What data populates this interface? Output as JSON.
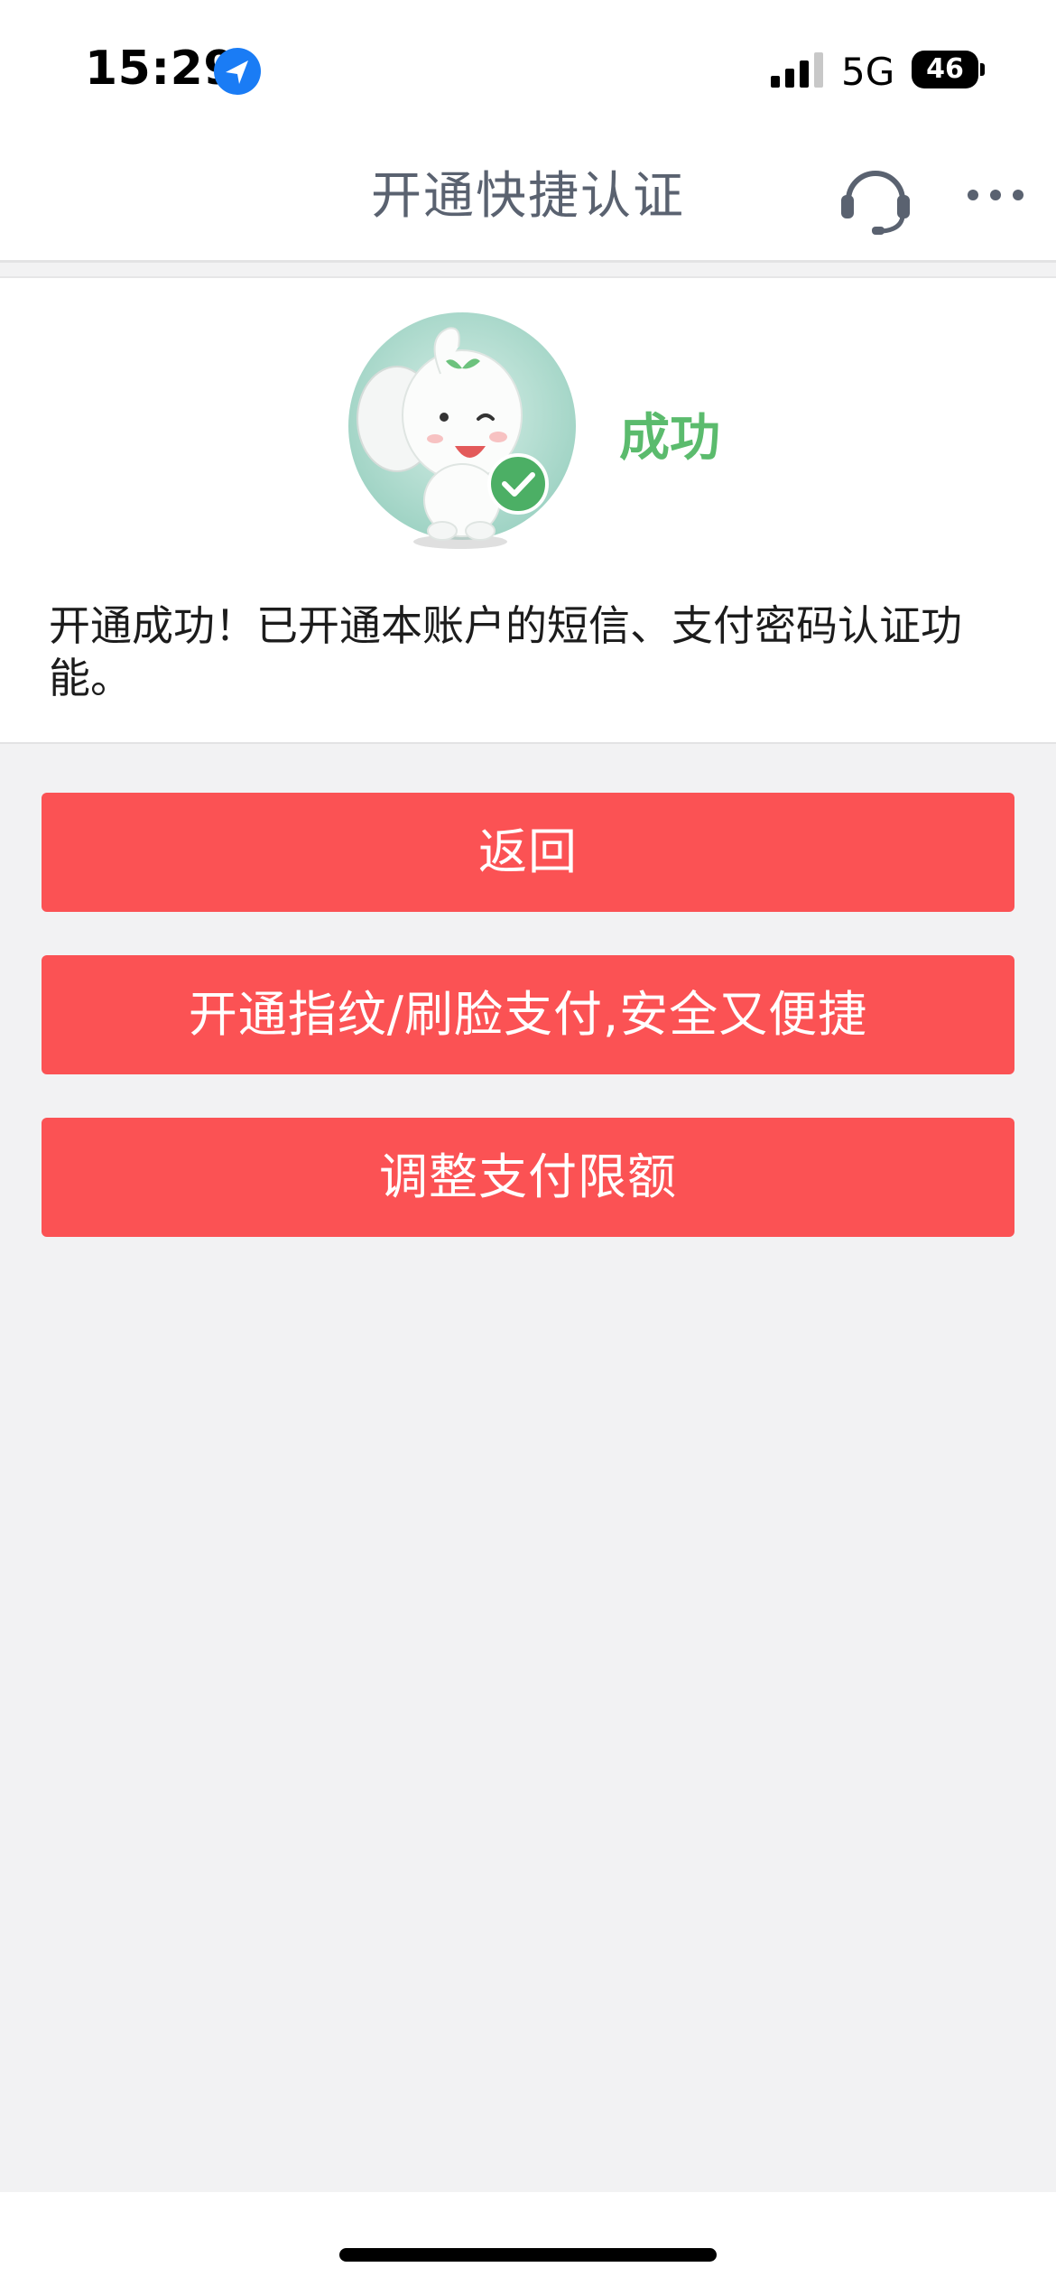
{
  "status_bar": {
    "time": "15:29",
    "network": "5G",
    "battery": "46",
    "icons": [
      "location-arrow-icon",
      "signal-bars-icon"
    ]
  },
  "nav": {
    "title": "开通快捷认证",
    "icons": [
      "headset-icon",
      "more-icon"
    ]
  },
  "result": {
    "status": "成功",
    "message": "开通成功！已开通本账户的短信、支付密码认证功能。",
    "image": "elephant-mascot-success"
  },
  "buttons": {
    "back": "返回",
    "biometric": "开通指纹/刷脸支付,安全又便捷",
    "limit": "调整支付限额"
  },
  "colors": {
    "primary_button": "#fb5254",
    "success_text": "#5bbb6d",
    "location_icon": "#1a7cf5"
  }
}
